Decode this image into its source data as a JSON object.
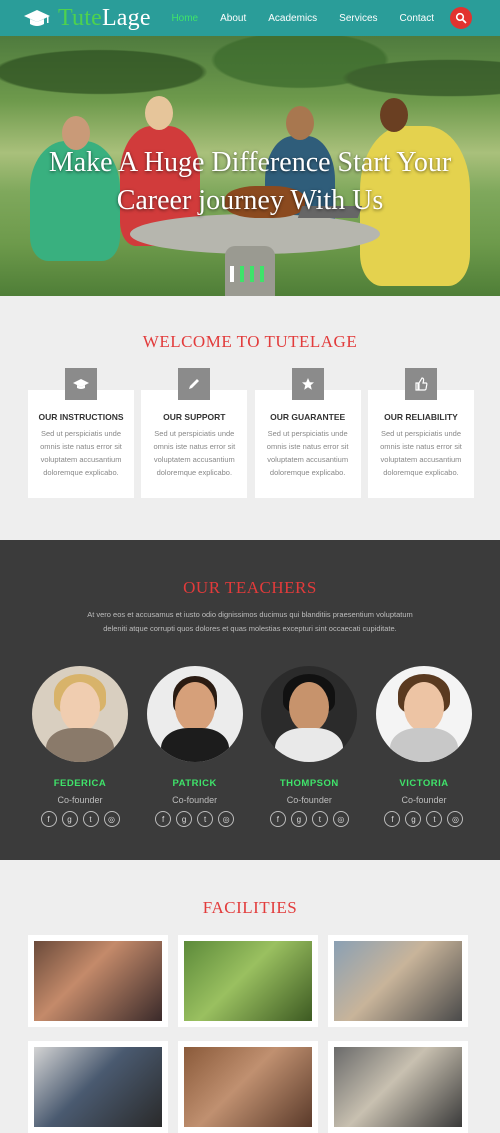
{
  "brand": {
    "name_part1": "Tute",
    "name_part2": "Lage"
  },
  "nav": {
    "items": [
      "Home",
      "About",
      "Academics",
      "Services",
      "Contact"
    ],
    "active": 0
  },
  "hero": {
    "title_line1": "Make A Huge Difference Start Your",
    "title_line2": "Career journey With Us"
  },
  "welcome": {
    "title": "WELCOME TO TUTELAGE",
    "cards": [
      {
        "icon": "graduation-cap-icon",
        "title": "OUR INSTRUCTIONS",
        "text": "Sed ut perspiciatis unde omnis iste natus error sit voluptatem accusantium doloremque explicabo."
      },
      {
        "icon": "pencil-icon",
        "title": "OUR SUPPORT",
        "text": "Sed ut perspiciatis unde omnis iste natus error sit voluptatem accusantium doloremque explicabo."
      },
      {
        "icon": "star-icon",
        "title": "OUR GUARANTEE",
        "text": "Sed ut perspiciatis unde omnis iste natus error sit voluptatem accusantium doloremque explicabo."
      },
      {
        "icon": "thumbs-up-icon",
        "title": "OUR RELIABILITY",
        "text": "Sed ut perspiciatis unde omnis iste natus error sit voluptatem accusantium doloremque explicabo."
      }
    ]
  },
  "teachers": {
    "title": "OUR TEACHERS",
    "text": "At vero eos et accusamus et iusto odio dignissimos ducimus qui blanditiis praesentium voluptatum deleniti atque corrupti quos dolores et quas molestias excepturi sint occaecati cupiditate.",
    "people": [
      {
        "name": "FEDERICA",
        "role": "Co-founder"
      },
      {
        "name": "PATRICK",
        "role": "Co-founder"
      },
      {
        "name": "THOMPSON",
        "role": "Co-founder"
      },
      {
        "name": "VICTORIA",
        "role": "Co-founder"
      }
    ],
    "social_icons": [
      "facebook-icon",
      "google-plus-icon",
      "twitter-icon",
      "dribbble-icon"
    ]
  },
  "facilities": {
    "title": "FACILITIES"
  },
  "colors": {
    "nav": "#2a9d99",
    "accent_green": "#3fe36a",
    "accent_red": "#e23b3b",
    "dark_section": "#3b3b3b"
  }
}
